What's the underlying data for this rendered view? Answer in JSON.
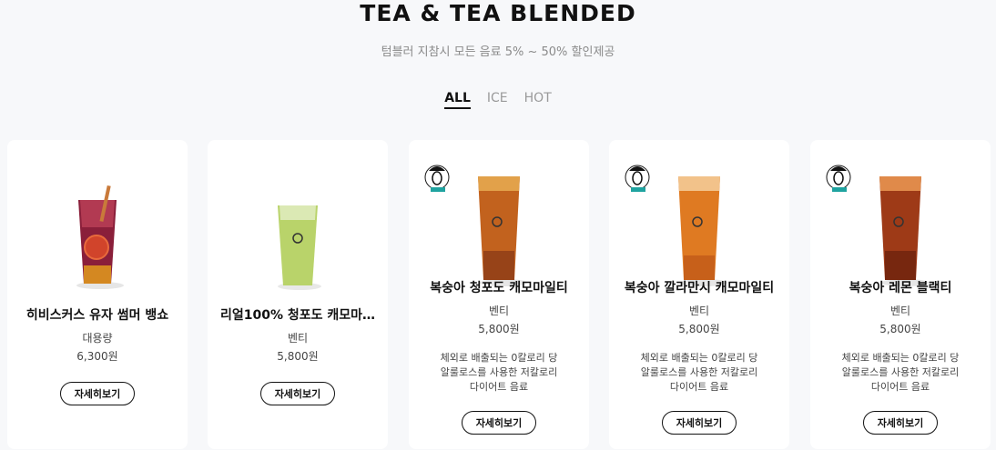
{
  "header": {
    "title": "TEA & TEA BLENDED",
    "subtitle": "텀블러 지참시 모든 음료 5% ~ 50% 할인제공"
  },
  "tabs": [
    {
      "label": "ALL",
      "active": true
    },
    {
      "label": "ICE",
      "active": false
    },
    {
      "label": "HOT",
      "active": false
    }
  ],
  "cards": [
    {
      "name": "히비스커스 유자 썸머 뱅쇼",
      "size": "대용량",
      "price": "6,300원",
      "desc": "",
      "button": "자세히보기",
      "badge": false,
      "drink_color": "#8a1f3a"
    },
    {
      "name": "리얼100% 청포도 캐모마…",
      "size": "벤티",
      "price": "5,800원",
      "desc": "",
      "button": "자세히보기",
      "badge": false,
      "drink_color": "#b9d36a"
    },
    {
      "name": "복숭아 청포도 캐모마일티",
      "size": "벤티",
      "price": "5,800원",
      "desc": "체외로 배출되는 0칼로리 당\n알룰로스를 사용한 저칼로리\n다이어트 음료",
      "button": "자세히보기",
      "badge": true,
      "drink_color": "#c2621e"
    },
    {
      "name": "복숭아 깔라만시 캐모마일티",
      "size": "벤티",
      "price": "5,800원",
      "desc": "체외로 배출되는 0칼로리 당\n알룰로스를 사용한 저칼로리\n다이어트 음료",
      "button": "자세히보기",
      "badge": true,
      "drink_color": "#df7a22"
    },
    {
      "name": "복숭아 레몬 블랙티",
      "size": "벤티",
      "price": "5,800원",
      "desc": "체외로 배출되는 0칼로리 당\n알룰로스를 사용한 저칼로리\n다이어트 음료",
      "button": "자세히보기",
      "badge": true,
      "drink_color": "#9e3a17"
    }
  ]
}
